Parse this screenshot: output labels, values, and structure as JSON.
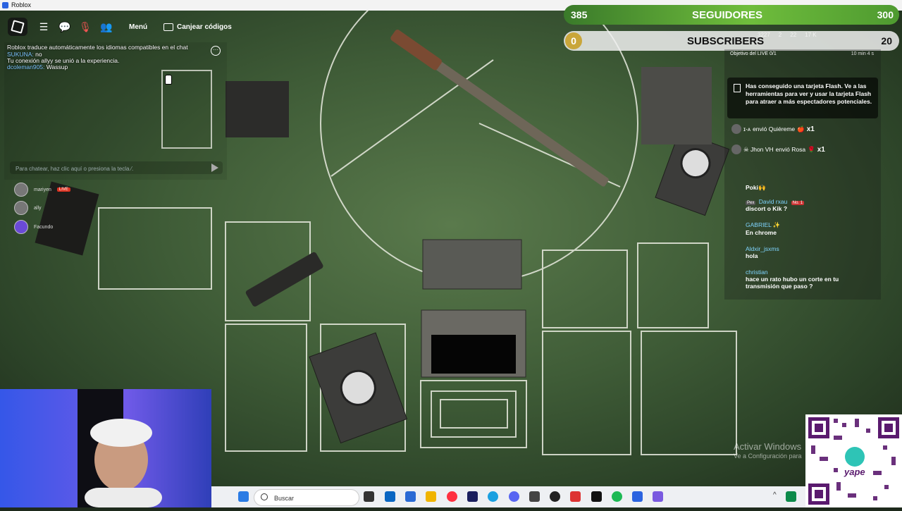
{
  "window": {
    "title": "Roblox"
  },
  "toolbar": {
    "menu_label": "Menú",
    "redeem_label": "Canjear códigos"
  },
  "chat": {
    "translate_notice": "Roblox traduce automáticamente los idiomas compatibles en el chat",
    "messages": [
      {
        "user": "SUKUNA:",
        "text": "no"
      },
      {
        "user": "",
        "text": "Tu conexión allyy se unió a la experiencia."
      },
      {
        "user": "dcoleman905:",
        "text": "Wassup"
      }
    ],
    "input_placeholder": "Para chatear, haz clic aquí o presiona la tecla ⁄."
  },
  "voice_users": [
    {
      "name": "mariyen",
      "live": "LIVE"
    },
    {
      "name": "ally",
      "live": ""
    },
    {
      "name": "Facundo",
      "live": ""
    }
  ],
  "overlay": {
    "followers_count": "385",
    "followers_label": "SEGUIDORES",
    "followers_goal": "300",
    "subs_count": "0",
    "subs_label": "SUBSCRIBERS",
    "subs_goal": "20"
  },
  "live_panel": {
    "goal_label": "Objetivo del LIVE 0/1",
    "goal_time": "10 min 4 s",
    "flash_card": "Has conseguido una tarjeta Flash. Ve a las herramientas para ver y usar la tarjeta Flash para atraer a más espectadores potenciales.",
    "gifts": [
      {
        "sender": "ɪ-ᴀ",
        "action": "envió Quiéreme",
        "count": "x1"
      },
      {
        "sender": "☠︎ Jhon VH",
        "action": "envió Rosa",
        "count": "x1"
      }
    ],
    "comments": [
      {
        "user": "",
        "text": "Poki🙌"
      },
      {
        "user": "David rxau",
        "badge": "No. 1",
        "tag": "Pex",
        "text": "discort o Kik ?"
      },
      {
        "user": "GABRIEL ✨",
        "text": "En chrome"
      },
      {
        "user": "Aldxir_jsxms",
        "text": "hola"
      },
      {
        "user": "christian",
        "text": "hace un rato hubo un corte en tu transmisión que paso ?"
      }
    ],
    "stats": {
      "players": "3227",
      "gifts": "2",
      "shares": "22",
      "likes": "17 K"
    }
  },
  "windows_watermark": {
    "line1": "Activar Windows",
    "line2": "Ve a Configuración para"
  },
  "taskbar": {
    "search_placeholder": "Buscar"
  },
  "colors": {
    "green_banner": "#6fbd3c",
    "table_green": "#4d6e43"
  }
}
